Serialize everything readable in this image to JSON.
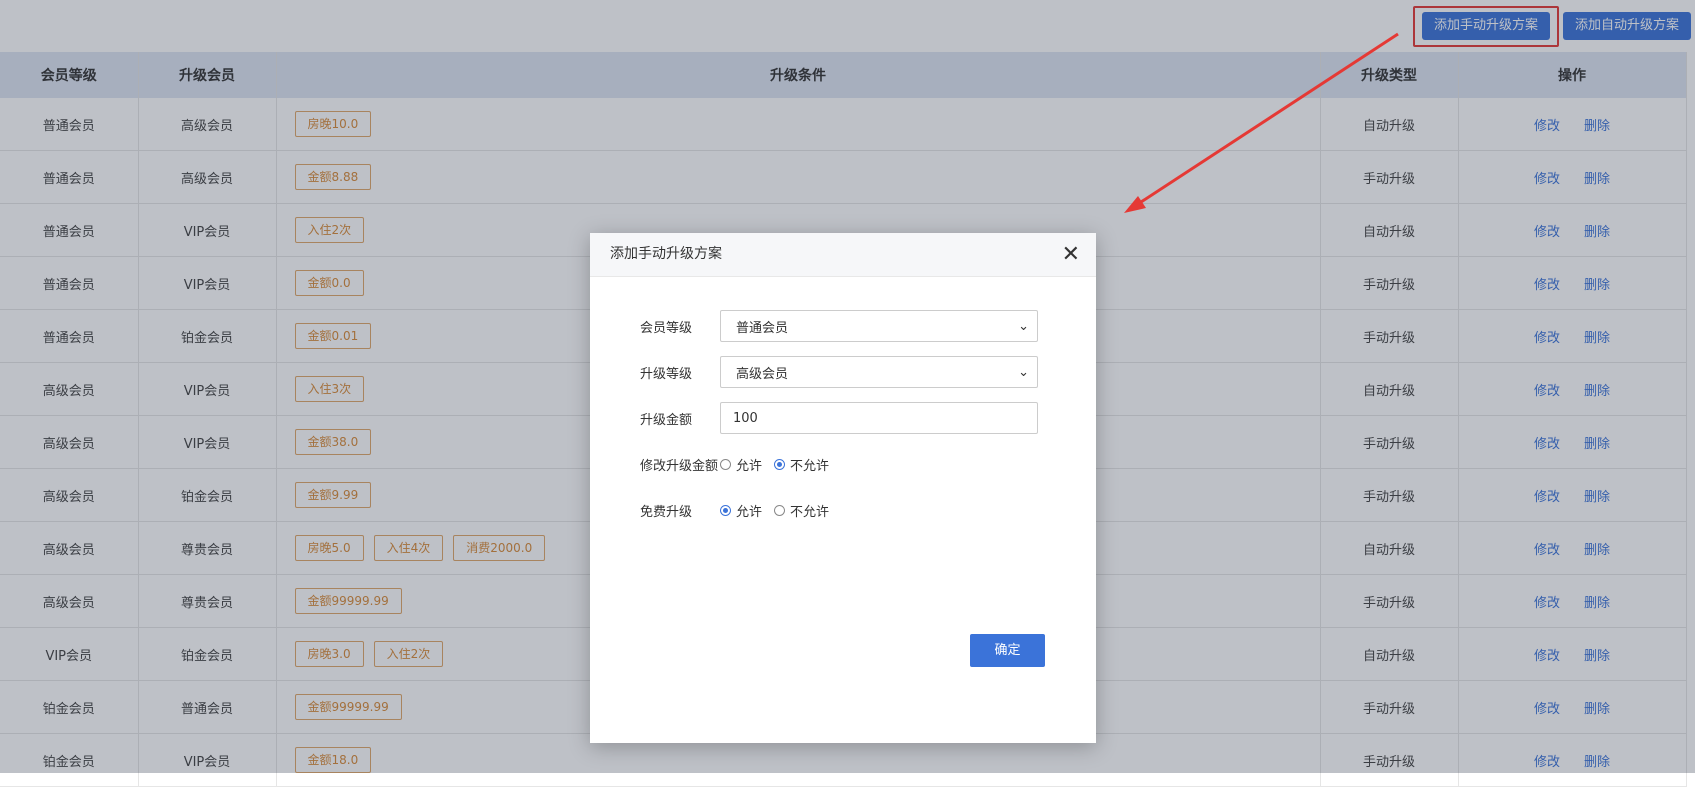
{
  "toolbar": {
    "add_manual_label": "添加手动升级方案",
    "add_auto_label": "添加自动升级方案"
  },
  "table": {
    "headers": [
      "会员等级",
      "升级会员",
      "升级条件",
      "升级类型",
      "操作"
    ],
    "rows": [
      {
        "level": "普通会员",
        "target": "高级会员",
        "conditions": [
          "房晚10.0"
        ],
        "type": "自动升级"
      },
      {
        "level": "普通会员",
        "target": "高级会员",
        "conditions": [
          "金额8.88"
        ],
        "type": "手动升级"
      },
      {
        "level": "普通会员",
        "target": "VIP会员",
        "conditions": [
          "入住2次"
        ],
        "type": "自动升级"
      },
      {
        "level": "普通会员",
        "target": "VIP会员",
        "conditions": [
          "金额0.0"
        ],
        "type": "手动升级"
      },
      {
        "level": "普通会员",
        "target": "铂金会员",
        "conditions": [
          "金额0.01"
        ],
        "type": "手动升级"
      },
      {
        "level": "高级会员",
        "target": "VIP会员",
        "conditions": [
          "入住3次"
        ],
        "type": "自动升级"
      },
      {
        "level": "高级会员",
        "target": "VIP会员",
        "conditions": [
          "金额38.0"
        ],
        "type": "手动升级"
      },
      {
        "level": "高级会员",
        "target": "铂金会员",
        "conditions": [
          "金额9.99"
        ],
        "type": "手动升级"
      },
      {
        "level": "高级会员",
        "target": "尊贵会员",
        "conditions": [
          "房晚5.0",
          "入住4次",
          "消费2000.0"
        ],
        "type": "自动升级"
      },
      {
        "level": "高级会员",
        "target": "尊贵会员",
        "conditions": [
          "金额99999.99"
        ],
        "type": "手动升级"
      },
      {
        "level": "VIP会员",
        "target": "铂金会员",
        "conditions": [
          "房晚3.0",
          "入住2次"
        ],
        "type": "自动升级"
      },
      {
        "level": "铂金会员",
        "target": "普通会员",
        "conditions": [
          "金额99999.99"
        ],
        "type": "手动升级"
      },
      {
        "level": "铂金会员",
        "target": "VIP会员",
        "conditions": [
          "金额18.0"
        ],
        "type": "手动升级"
      }
    ],
    "edit_label": "修改",
    "delete_label": "删除"
  },
  "modal": {
    "title": "添加手动升级方案",
    "close_icon": "close-icon",
    "fields": {
      "member_level_label": "会员等级",
      "member_level_value": "普通会员",
      "upgrade_level_label": "升级等级",
      "upgrade_level_value": "高级会员",
      "amount_label": "升级金额",
      "amount_value": "100",
      "modify_amount_label": "修改升级金额",
      "free_upgrade_label": "免费升级",
      "allow_label": "允许",
      "disallow_label": "不允许"
    },
    "modify_amount_selected": "不允许",
    "free_upgrade_selected": "允许",
    "confirm_label": "确定"
  },
  "colors": {
    "primary": "#3b73d9",
    "highlight": "#e53935",
    "tag": "#d98c3a"
  }
}
